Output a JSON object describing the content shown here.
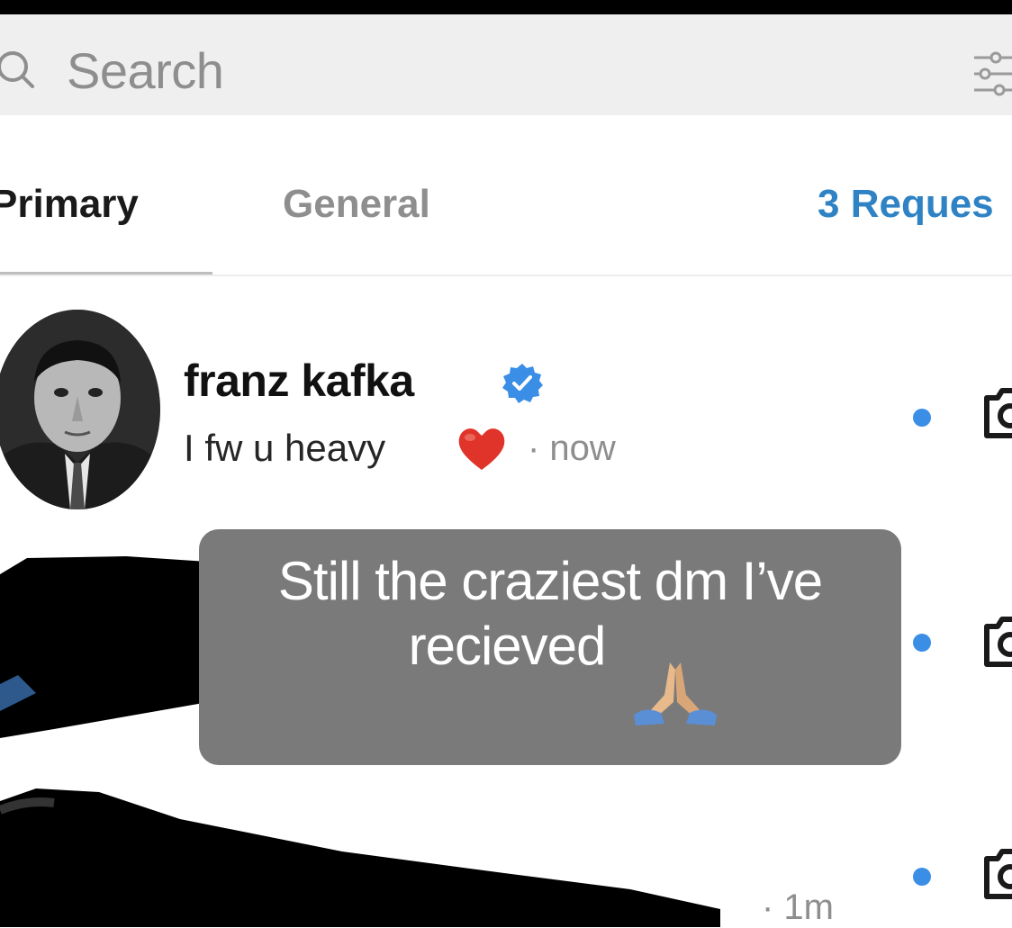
{
  "search": {
    "placeholder": "Search"
  },
  "tabs": [
    {
      "label": "Primary"
    },
    {
      "label": "General"
    },
    {
      "label": "3 Reques"
    }
  ],
  "threads": [
    {
      "name": "franz kafka",
      "verified": true,
      "preview": "I fw u heavy",
      "emoji": "red-heart",
      "time": "· now",
      "unread": true
    },
    {
      "unread": true
    },
    {
      "time": "· 1m",
      "unread": true
    }
  ],
  "caption": {
    "line1": "Still the craziest dm I’ve",
    "line2": "recieved"
  },
  "colors": {
    "accent": "#3a8ee6",
    "requests": "#2f83c4",
    "muted": "#8e8e8e",
    "caption_bg": "#7a7a7a"
  }
}
